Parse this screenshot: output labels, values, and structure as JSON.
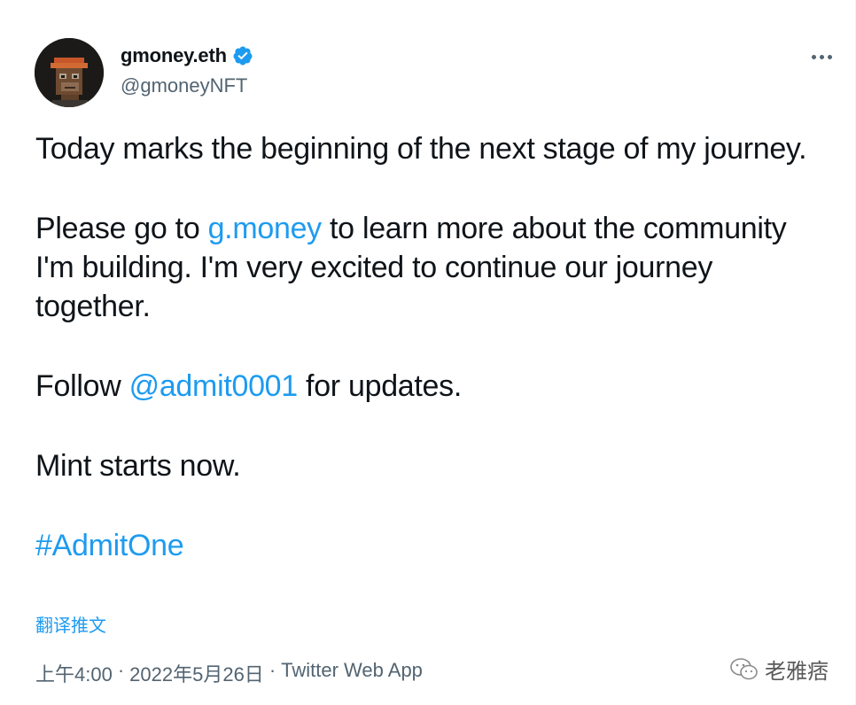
{
  "author": {
    "display_name": "gmoney.eth",
    "handle": "@gmoneyNFT",
    "verified_icon": "verified-badge-icon",
    "avatar_icon": "pixel-ape-avatar"
  },
  "menu": {
    "more_icon": "more-dots-icon"
  },
  "tweet": {
    "line1": "Today marks the beginning of the next stage of my journey.",
    "p2_before": "Please go to ",
    "p2_link": "g.money",
    "p2_after": " to learn more about the community I'm building.  I'm very excited to continue our journey together.",
    "p3_before": "Follow ",
    "p3_mention": "@admit0001",
    "p3_after": " for updates.",
    "p4": "Mint starts now.",
    "hashtag": "#AdmitOne"
  },
  "translate_label": "翻译推文",
  "meta": {
    "time": "上午4:00",
    "date": "2022年5月26日",
    "source": "Twitter Web App",
    "separator": "·"
  },
  "watermark": {
    "text": "老雅痞",
    "icon": "wechat-icon"
  },
  "colors": {
    "link": "#1d9bf0",
    "text": "#0f1419",
    "secondary": "#536471"
  }
}
